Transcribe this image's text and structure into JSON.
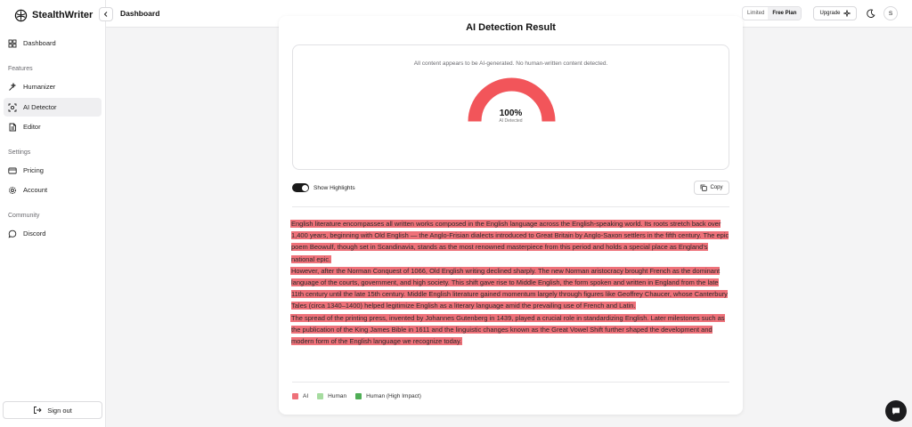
{
  "app": {
    "name": "StealthWriter"
  },
  "sidebar": {
    "items": [
      {
        "label": "Dashboard",
        "icon": "dashboard-icon"
      },
      {
        "label": "Humanizer",
        "icon": "humanizer-icon"
      },
      {
        "label": "AI Detector",
        "icon": "ai-detector-icon",
        "active": true
      },
      {
        "label": "Editor",
        "icon": "editor-icon"
      },
      {
        "label": "Pricing",
        "icon": "credit-card-icon"
      },
      {
        "label": "Account",
        "icon": "gear-icon"
      },
      {
        "label": "Discord",
        "icon": "chat-bubble-icon"
      }
    ],
    "sections": {
      "features": "Features",
      "settings": "Settings",
      "community": "Community"
    },
    "signout_label": "Sign out"
  },
  "header": {
    "title": "Dashboard",
    "plan_status": "Limited",
    "plan_name": "Free Plan",
    "upgrade_label": "Upgrade",
    "avatar_initial": "S"
  },
  "result": {
    "heading": "AI Detection Result",
    "message": "All content appears to be AI-generated. No human-written content detected.",
    "percent": "100%",
    "percent_value": 1.0,
    "percent_label": "AI Detected",
    "gauge_color": "#f2555a"
  },
  "controls": {
    "show_highlights_label": "Show Highlights",
    "show_highlights_on": true,
    "copy_label": "Copy"
  },
  "text": {
    "paragraphs": [
      [
        "English literature encompasses all written works composed in the English language across the English-speaking world.",
        "Its roots stretch back over 1,400 years, beginning with Old English — the Anglo-Frisian dialects introduced to Great Britain by Anglo-Saxon settlers in the fifth century.",
        "The epic poem Beowulf, though set in Scandinavia, stands as the most renowned masterpiece from this period and holds a special place as England's national epic."
      ],
      [
        "However, after the Norman Conquest of 1066, Old English writing declined sharply.",
        "The new Norman aristocracy brought French as the dominant language of the courts, government, and high society.",
        "This shift gave rise to Middle English, the form spoken and written in England from the late 11th century until the late 15th century.",
        "Middle English literature gained momentum largely through figures like Geoffrey Chaucer, whose Canterbury Tales (circa 1340–1400) helped legitimize English as a literary language amid the prevailing use of French and Latin."
      ],
      [
        "The spread of the printing press, invented by Johannes Gutenberg in 1439, played a crucial role in standardizing English.",
        "Later milestones such as the publication of the King James Bible in 1611 and the linguistic changes known as the Great Vowel Shift further shaped the development and modern form of the English language we recognize today."
      ]
    ]
  },
  "legend": [
    {
      "label": "AI",
      "color": "#ee7179"
    },
    {
      "label": "Human",
      "color": "#a6dca0"
    },
    {
      "label": "Human (High Impact)",
      "color": "#4fae56"
    }
  ],
  "colors": {
    "accent_dark": "#1a1a1a",
    "ai_highlight": "#ee7179"
  }
}
